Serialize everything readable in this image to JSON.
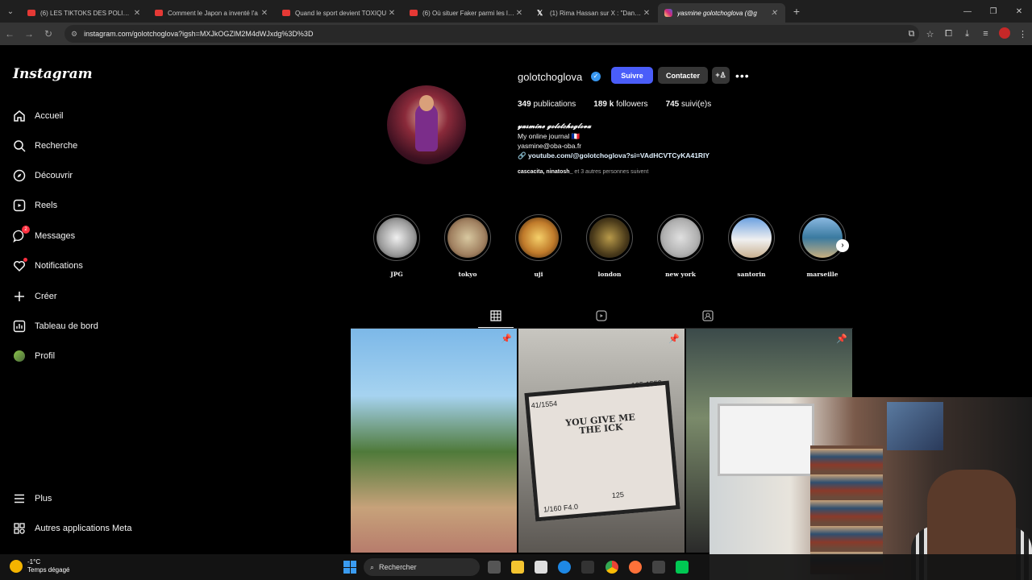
{
  "browser": {
    "tabs": [
      {
        "title": "(6) LES TIKTOKS DES POLITIQUES",
        "fav": "yt"
      },
      {
        "title": "Comment le Japon a inventé l'a",
        "fav": "yt"
      },
      {
        "title": "Quand le sport devient TOXIQU",
        "fav": "yt"
      },
      {
        "title": "(6) Où situer Faker parmi les lég",
        "fav": "yt"
      },
      {
        "title": "(1) Rima Hassan sur X : \"Dans u",
        "fav": "x"
      },
      {
        "title": "yasmine golotchoglova (@g",
        "fav": "ig"
      }
    ],
    "url": "instagram.com/golotchoglova?igsh=MXJkOGZlM2M4dWJxdg%3D%3D"
  },
  "sidebar": {
    "logo": "Instagram",
    "items": [
      {
        "label": "Accueil",
        "icon": "home-icon"
      },
      {
        "label": "Recherche",
        "icon": "search-icon"
      },
      {
        "label": "Découvrir",
        "icon": "compass-icon"
      },
      {
        "label": "Reels",
        "icon": "reels-icon"
      },
      {
        "label": "Messages",
        "icon": "messenger-icon",
        "badge": "2"
      },
      {
        "label": "Notifications",
        "icon": "heart-icon"
      },
      {
        "label": "Créer",
        "icon": "plus-icon"
      },
      {
        "label": "Tableau de bord",
        "icon": "dashboard-icon"
      },
      {
        "label": "Profil",
        "icon": "avatar-icon"
      }
    ],
    "bottom": [
      {
        "label": "Plus",
        "icon": "menu-icon"
      },
      {
        "label": "Autres applications Meta",
        "icon": "meta-apps-icon"
      }
    ]
  },
  "profile": {
    "username": "golotchoglova",
    "follow_label": "Suivre",
    "contact_label": "Contacter",
    "stats": {
      "posts_count": "349",
      "posts_label": "publications",
      "followers_count": "189 k",
      "followers_label": "followers",
      "following_count": "745",
      "following_label": "suivi(e)s"
    },
    "bio": {
      "name": "𝔂𝓪𝓼𝓶𝓲𝓷𝓮 𝓰𝓸𝓵𝓸𝓽𝓬𝓱𝓸𝓰𝓵𝓸𝓿𝓪",
      "line1": "My online journal 🇫🇷",
      "email": "yasmine@oba-oba.fr",
      "link": "youtube.com/@golotchoglova?si=VAdHCVTCyKA41RIY"
    },
    "followed_by": {
      "names": "cascacita, ninatosh_",
      "rest": " et 3 autres personnes suivent"
    }
  },
  "highlights": [
    "𝐉𝐏𝐆",
    "𝐭𝐨𝐤𝐲𝐨",
    "𝐮𝐣𝐢",
    "𝐥𝐨𝐧𝐝𝐨𝐧",
    "𝐧𝐞𝐰 𝐲𝐨𝐫𝐤",
    "𝐬𝐚𝐧𝐭𝐨𝐫𝐢𝐧",
    "𝐦𝐚𝐫𝐬𝐞𝐢𝐥𝐥𝐞"
  ],
  "posts": {
    "camera_text": "YOU GIVE ME THE ICK",
    "counter_left": "41/1554",
    "counter_right": "105-1552",
    "shutter": "1/160  F4.0",
    "iso": "125"
  },
  "taskbar": {
    "temp": "-1°C",
    "weather": "Temps dégagé",
    "search_label": "Rechercher"
  }
}
